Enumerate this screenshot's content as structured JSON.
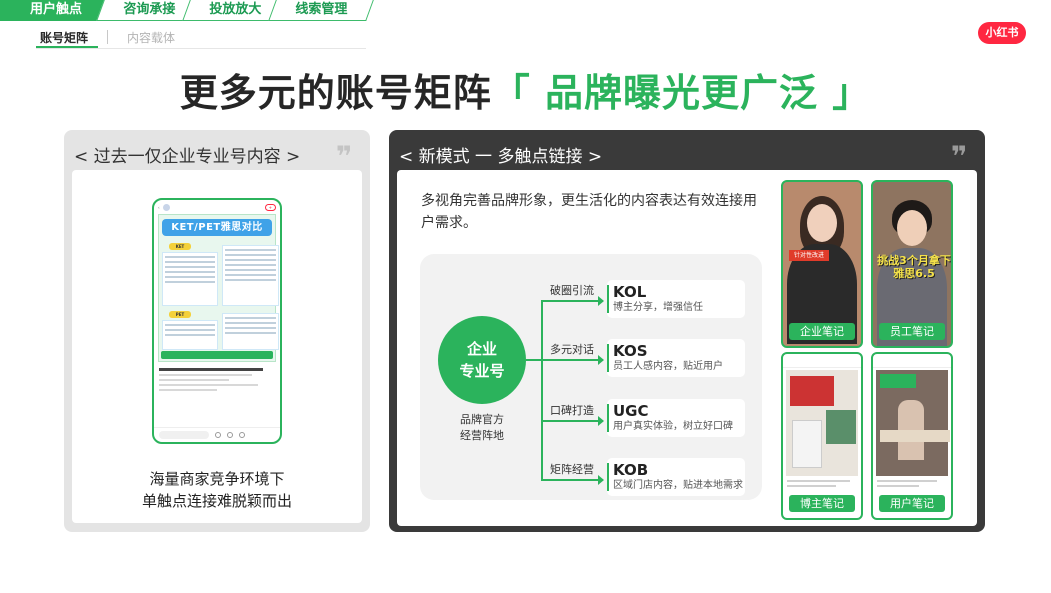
{
  "nav": {
    "tabs": [
      "用户触点",
      "咨询承接",
      "投放放大",
      "线索管理"
    ],
    "active_tab": "用户触点",
    "sub_tabs": [
      "账号矩阵",
      "内容载体"
    ],
    "active_sub_tab": "账号矩阵"
  },
  "brand_logo": "小红书",
  "title": {
    "main": "更多元的账号矩阵",
    "accent": "「 品牌曝光更广泛 」"
  },
  "left_panel": {
    "heading": "< 过去一仅企业专业号内容 >",
    "caption_line1": "海量商家竞争环境下",
    "caption_line2": "单触点连接难脱颖而出",
    "phone_poster_title": "KET/PET雅思对比",
    "phone_label_a": "KET",
    "phone_label_b": "PET"
  },
  "right_panel": {
    "heading": "< 新模式 一 多触点链接 >",
    "description": "多视角完善品牌形象，更生活化的内容表达有效连接用户需求。",
    "hub": {
      "line1": "企业",
      "line2": "专业号",
      "caption_line1": "品牌官方",
      "caption_line2": "经营阵地"
    },
    "branches": [
      {
        "label": "破圈引流",
        "title": "KOL",
        "subtitle": "博主分享，增强信任"
      },
      {
        "label": "多元对话",
        "title": "KOS",
        "subtitle": "员工人感内容，贴近用户"
      },
      {
        "label": "口碑打造",
        "title": "UGC",
        "subtitle": "用户真实体验，树立好口碑"
      },
      {
        "label": "矩阵经营",
        "title": "KOB",
        "subtitle": "区域门店内容，贴进本地需求"
      }
    ],
    "thumbnails": [
      {
        "badge": "企业笔记",
        "overlay": "针对性改进"
      },
      {
        "badge": "员工笔记",
        "overlay": "挑战3个月拿下雅思6.5"
      },
      {
        "badge": "博主笔记"
      },
      {
        "badge": "用户笔记"
      }
    ]
  },
  "colors": {
    "brand_green": "#2bb35c",
    "dark_panel": "#3a3a3a",
    "light_panel": "#e4e4e4",
    "xhs_red": "#ff2741"
  }
}
